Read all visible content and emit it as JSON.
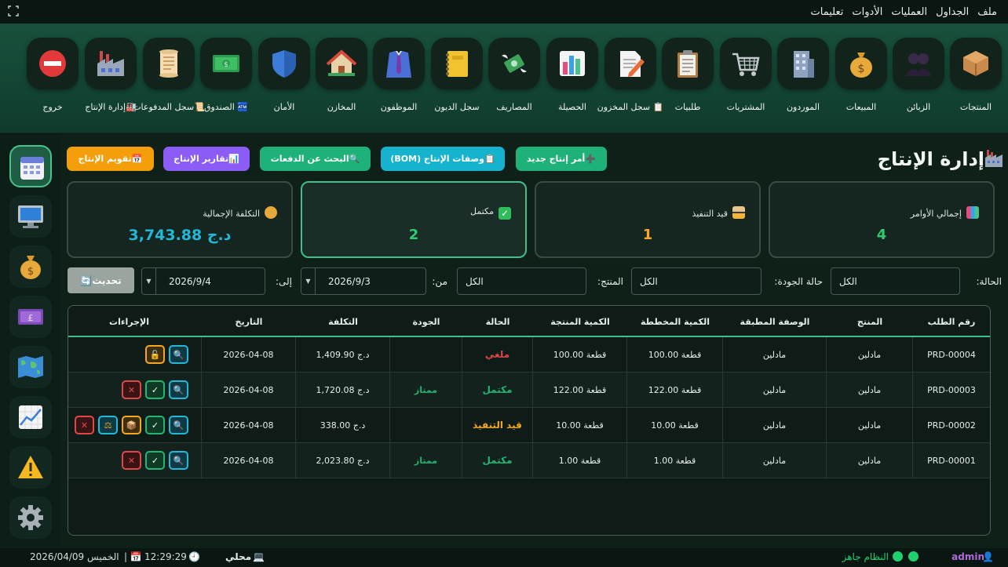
{
  "menu": [
    "ملف",
    "الجداول",
    "العمليات",
    "الأدوات",
    "تعليمات"
  ],
  "toolbar": [
    {
      "label": "المنتجات",
      "icon": "box-icon"
    },
    {
      "label": "الزبائن",
      "icon": "customers-icon"
    },
    {
      "label": "المبيعات",
      "icon": "money-bag-icon"
    },
    {
      "label": "الموردون",
      "icon": "building-icon"
    },
    {
      "label": "المشتريات",
      "icon": "cart-icon"
    },
    {
      "label": "طلبيات",
      "icon": "clipboard-icon"
    },
    {
      "label": "📋 سجل المخزون",
      "icon": "memo-icon"
    },
    {
      "label": "الحصيلة",
      "icon": "bar-chart-icon"
    },
    {
      "label": "المصاريف",
      "icon": "money-wings-icon"
    },
    {
      "label": "سجل الديون",
      "icon": "notebook-icon"
    },
    {
      "label": "الموظفون",
      "icon": "suit-icon"
    },
    {
      "label": "المخازن",
      "icon": "house-icon"
    },
    {
      "label": "الأمان",
      "icon": "shield-icon"
    },
    {
      "label": "🏧 الصندوق",
      "icon": "cash-icon"
    },
    {
      "label": "📜سجل المدفوعات",
      "icon": "scroll-icon"
    },
    {
      "label": "🏭إدارة الإنتاج",
      "icon": "factory-icon"
    },
    {
      "label": "خروج",
      "icon": "no-entry-icon"
    }
  ],
  "sidebar": [
    "calendar-icon",
    "monitor-icon",
    "money-bag-icon",
    "pound-note-icon",
    "world-map-icon",
    "chart-up-icon",
    "warning-icon",
    "gear-icon"
  ],
  "page": {
    "title": "إدارة الإنتاج"
  },
  "actions": [
    {
      "label": "➕أمر إنتاج جديد",
      "color": "#1eb27a"
    },
    {
      "label": "📋وصفات الإنتاج (BOM)",
      "color": "#16b3cf"
    },
    {
      "label": "🔍البحث عن الدفعات",
      "color": "#1eb27a"
    },
    {
      "label": "📊تقارير الإنتاج",
      "color": "#8b5cf6"
    },
    {
      "label": "📅تقويم الإنتاج",
      "color": "#f59e0b"
    }
  ],
  "stats": [
    {
      "label": "إجمالي الأوامر",
      "value": "4",
      "color": "#2ecc71"
    },
    {
      "label": "قيد التنفيذ",
      "value": "1",
      "color": "#f5a623"
    },
    {
      "label": "مكتمل",
      "value": "2",
      "color": "#2ecc71"
    },
    {
      "label": "التكلفة الإجمالية",
      "value": "3,743.88 د.ج",
      "color": "#22b8d6"
    }
  ],
  "filters": {
    "status_label": "الحالة:",
    "status_value": "الكل",
    "quality_label": "حالة الجودة:",
    "quality_value": "الكل",
    "product_label": "المنتج:",
    "product_value": "الكل",
    "from_label": "من:",
    "from_value": "2026/9/3",
    "to_label": "إلى:",
    "to_value": "2026/9/4",
    "refresh_label": "🔄تحديث"
  },
  "table": {
    "headers": [
      "رقم الطلب",
      "المنتج",
      "الوصفة المطبقة",
      "الكمية المخططة",
      "الكمية المنتجة",
      "الحالة",
      "الجودة",
      "التكلفة",
      "التاريخ",
      "الإجراءات"
    ],
    "rows": [
      {
        "id": "PRD-00004",
        "product": "مادلين",
        "recipe": "مادلين",
        "planned": "100.00 قطعة",
        "produced": "100.00 قطعة",
        "status": "ملغي",
        "status_color": "#e04848",
        "quality": "",
        "cost": "1,409.90 د.ج",
        "date": "2026-04-08",
        "actions": [
          "view",
          "unlock"
        ]
      },
      {
        "id": "PRD-00003",
        "product": "مادلين",
        "recipe": "مادلين",
        "planned": "122.00 قطعة",
        "produced": "122.00 قطعة",
        "status": "مكتمل",
        "status_color": "#22b573",
        "quality": "ممتاز",
        "cost": "1,720.08 د.ج",
        "date": "2026-04-08",
        "actions": [
          "view",
          "check",
          "delete"
        ]
      },
      {
        "id": "PRD-00002",
        "product": "مادلين",
        "recipe": "مادلين",
        "planned": "10.00 قطعة",
        "produced": "10.00 قطعة",
        "status": "قيد التنفيذ",
        "status_color": "#f5a623",
        "quality": "",
        "cost": "338.00 د.ج",
        "date": "2026-04-08",
        "actions": [
          "view",
          "check",
          "package",
          "scale",
          "delete"
        ]
      },
      {
        "id": "PRD-00001",
        "product": "مادلين",
        "recipe": "مادلين",
        "planned": "1.00 قطعة",
        "produced": "1.00 قطعة",
        "status": "مكتمل",
        "status_color": "#22b573",
        "quality": "ممتاز",
        "cost": "2,023.80 د.ج",
        "date": "2026-04-08",
        "actions": [
          "view",
          "check",
          "delete"
        ]
      }
    ]
  },
  "statusbar": {
    "user": "admin",
    "system": "النظام جاهز",
    "mode": "محلي",
    "time": "12:29:29",
    "date": "الخميس 2026/04/09"
  }
}
